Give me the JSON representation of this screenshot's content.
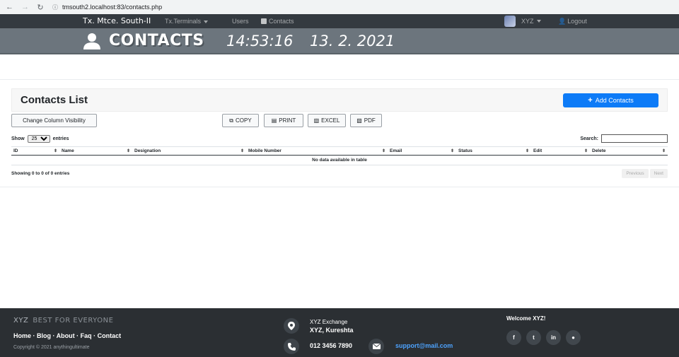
{
  "browser": {
    "url": "tmsouth2.localhost:83/contacts.php"
  },
  "navbar": {
    "brand": "Tx. Mtce. South-II",
    "terminals": "Tx.Terminals",
    "users": "Users",
    "contacts": "Contacts",
    "user_name": "XYZ",
    "logout": "Logout"
  },
  "banner": {
    "title": "CONTACTS",
    "time": "14:53:16",
    "date": "13. 2. 2021"
  },
  "card": {
    "title": "Contacts List",
    "add_button": "Add Contacts"
  },
  "toolbar": {
    "column_visibility": "Change Column Visibility",
    "copy": "COPY",
    "print": "PRINT",
    "excel": "EXCEL",
    "pdf": "PDF"
  },
  "length": {
    "show": "Show",
    "value": "25",
    "entries": "entries"
  },
  "search": {
    "label": "Search:"
  },
  "table": {
    "columns": [
      "ID",
      "Name",
      "Designation",
      "Mobile Number",
      "Email",
      "Status",
      "Edit",
      "Delete"
    ],
    "empty": "No data available in table"
  },
  "info": {
    "text": "Showing 0 to 0 of 0 entries",
    "previous": "Previous",
    "next": "Next"
  },
  "footer": {
    "brand": "XYZ",
    "tagline": "BEST FOR EVERYONE",
    "links": "Home · Blog · About · Faq · Contact",
    "copyright": "Copyright © 2021 anythingultimate",
    "org_line1": "XYZ Exchange",
    "org_line2": "XYZ, Kureshta",
    "phone": "012 3456 7890",
    "email": "support@mail.com",
    "welcome": "Welcome XYZ!"
  },
  "colors": {
    "navbar": "#343a40",
    "banner": "#6c757d",
    "primary": "#0d7bf7",
    "footer": "#2b2f33"
  }
}
